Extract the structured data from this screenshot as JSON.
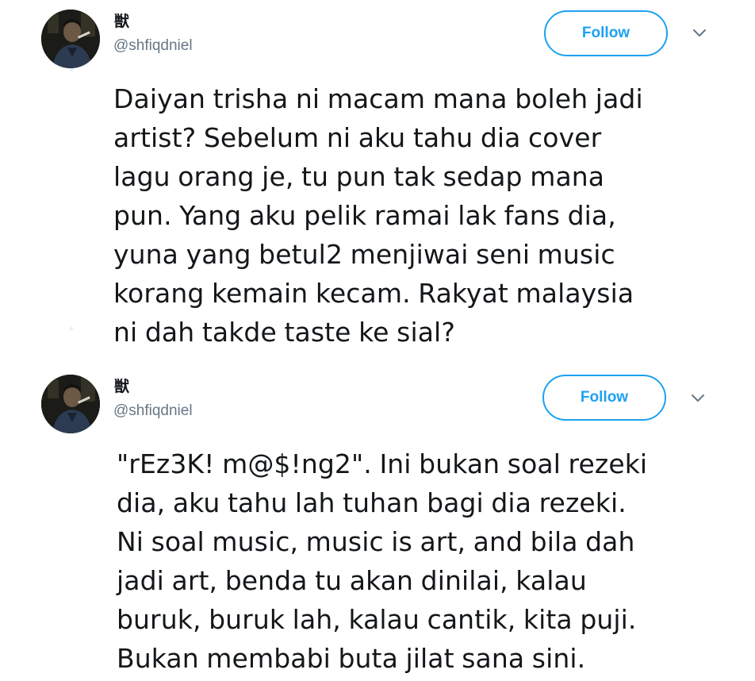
{
  "tweets": [
    {
      "display_name": "獣",
      "handle": "@shfiqdniel",
      "follow_label": "Follow",
      "caret_icon": "chevron-down-icon",
      "text": "Daiyan trisha ni macam mana boleh jadi\nartist? Sebelum ni aku tahu dia cover\nlagu orang je, tu pun tak sedap mana\npun. Yang aku pelik ramai lak fans dia,\nyuna yang betul2 menjiwai seni music\nkorang kemain kecam. Rakyat malaysia\nni dah takde taste ke sial?"
    },
    {
      "display_name": "獣",
      "handle": "@shfiqdniel",
      "follow_label": "Follow",
      "caret_icon": "chevron-down-icon",
      "text": "\"rEz3K! m@$!ng2\". Ini bukan soal rezeki\ndia, aku tahu lah tuhan bagi dia rezeki.\nNi soal music, music is art, and bila dah\njadi art, benda tu akan dinilai, kalau\nburuk, buruk lah, kalau cantik, kita puji.\nBukan membabi buta jilat sana sini."
    }
  ],
  "colors": {
    "accent": "#1da1f2",
    "text": "#14171a",
    "muted": "#657786",
    "background": "#ffffff"
  }
}
